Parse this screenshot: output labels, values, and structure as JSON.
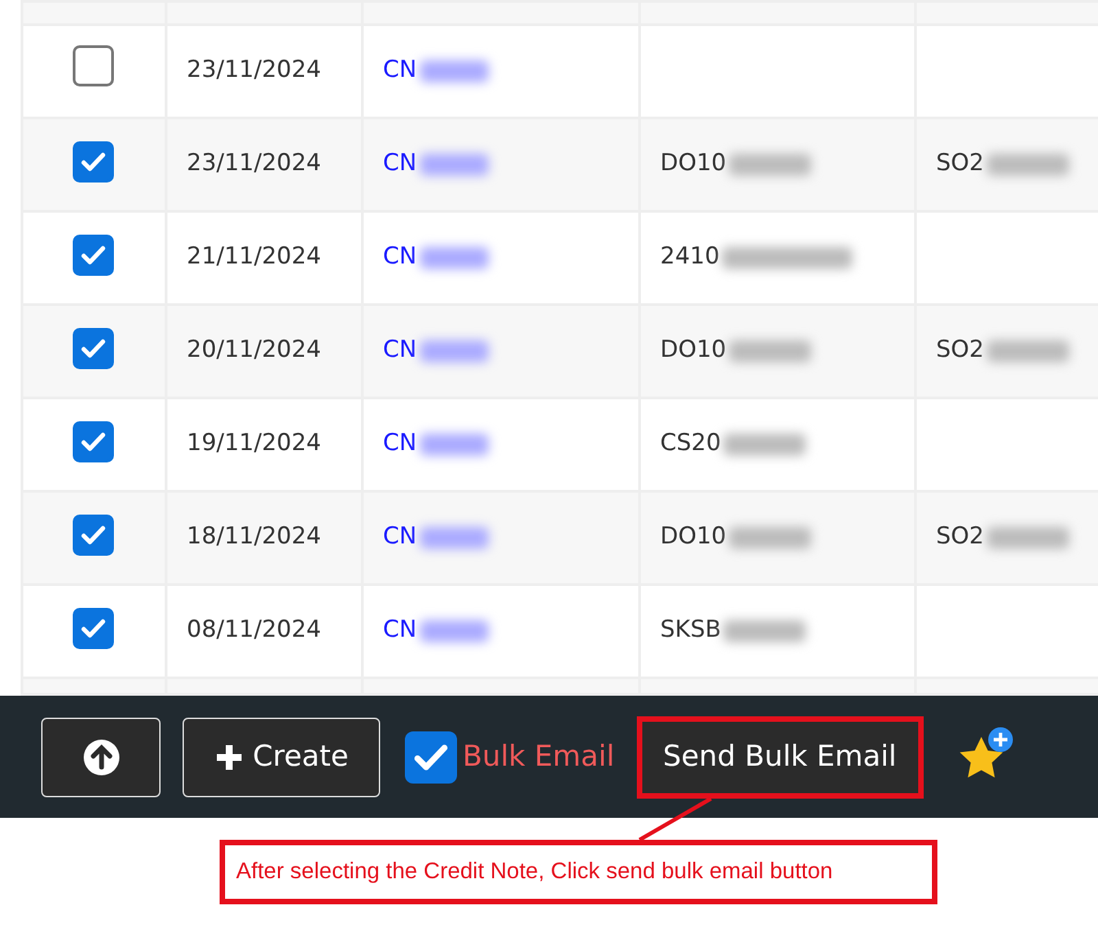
{
  "table": {
    "rows": [
      {
        "checked": false,
        "date": "23/11/2024",
        "credit_note": "CN"
      },
      {
        "checked": true,
        "date": "23/11/2024",
        "credit_note": "CN",
        "column_4": "DO10",
        "column_5": "SO2"
      },
      {
        "checked": true,
        "date": "21/11/2024",
        "credit_note": "CN",
        "column_4": "2410"
      },
      {
        "checked": true,
        "date": "20/11/2024",
        "credit_note": "CN",
        "column_4": "DO10",
        "column_5": "SO2"
      },
      {
        "checked": true,
        "date": "19/11/2024",
        "credit_note": "CN",
        "column_4": "CS20"
      },
      {
        "checked": true,
        "date": "18/11/2024",
        "credit_note": "CN",
        "column_4": "DO10",
        "column_5": "SO2"
      },
      {
        "checked": true,
        "date": "08/11/2024",
        "credit_note": "CN",
        "column_4": "SKSB"
      }
    ]
  },
  "toolbar": {
    "create_label": "Create",
    "bulk_email": {
      "label": "Bulk Email",
      "checked": true
    },
    "send_button": {
      "label": "Send Bulk Email",
      "highlighted": true
    }
  },
  "callout": {
    "text": "After selecting the Credit Note, Click send bulk email button"
  }
}
